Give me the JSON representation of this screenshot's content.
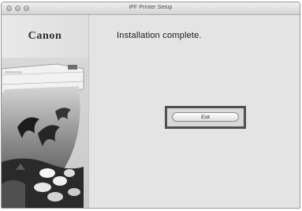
{
  "window": {
    "title": "iPF Printer Setup"
  },
  "sidebar": {
    "logo_text": "Canon"
  },
  "main": {
    "headline": "Installation complete.",
    "exit_button_label": "Exit"
  }
}
